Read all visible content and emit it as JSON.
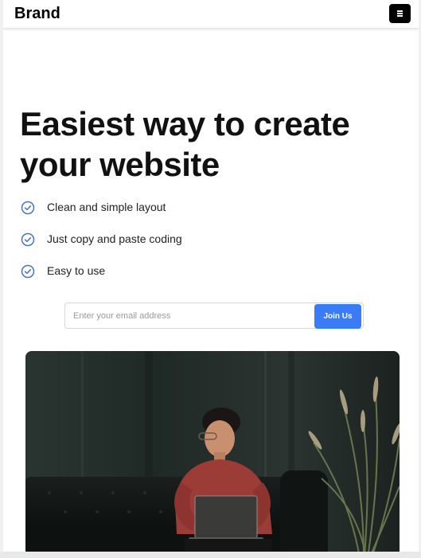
{
  "navbar": {
    "brand": "Brand",
    "menu_icon": "hamburger-menu-icon"
  },
  "hero": {
    "headline_line1": "Easiest way to create",
    "headline_line2": "your website",
    "features": [
      {
        "label": "Clean and simple layout",
        "icon": "check-circle-icon"
      },
      {
        "label": "Just copy and paste coding",
        "icon": "check-circle-icon"
      },
      {
        "label": "Easy to use",
        "icon": "check-circle-icon"
      }
    ],
    "signup": {
      "placeholder": "Enter your email address",
      "button_label": "Join Us"
    },
    "image": "photo-person-with-laptop-on-couch"
  },
  "colors": {
    "accent": "#3a7bf7",
    "check_icon": "#4a72c4",
    "menu_button": "#000000"
  }
}
